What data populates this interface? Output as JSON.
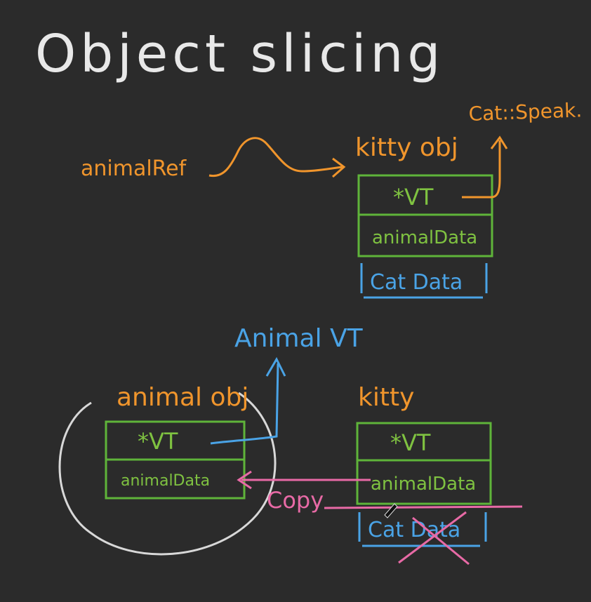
{
  "title": "Object slicing",
  "colors": {
    "background": "#2b2b2b",
    "chalk": "#e8e8e8",
    "orange": "#f0952c",
    "green": "#7fc241",
    "blue": "#4aa3e6",
    "pink": "#e86aa6",
    "box_stroke": "#5fb43a"
  },
  "top": {
    "animal_ref_label": "animalRef",
    "kitty_obj_label": "kitty obj",
    "cat_speak_label": "Cat::Speak.",
    "rows": [
      "*VT",
      "animalData",
      "Cat Data"
    ]
  },
  "middle": {
    "animal_vt_label": "Animal VT"
  },
  "bottom_left": {
    "label": "animal obj",
    "rows": [
      "*VT",
      "animalData"
    ]
  },
  "bottom_right": {
    "label": "kitty",
    "rows": [
      "*VT",
      "animalData",
      "Cat Data"
    ]
  },
  "copy_label": "Copy"
}
